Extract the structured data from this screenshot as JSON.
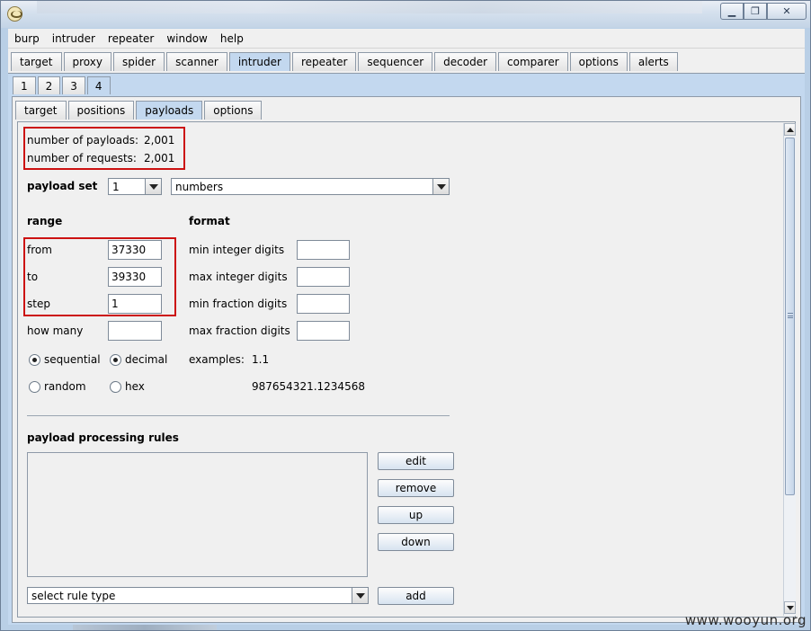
{
  "menu": [
    "burp",
    "intruder",
    "repeater",
    "window",
    "help"
  ],
  "main_tabs": [
    "target",
    "proxy",
    "spider",
    "scanner",
    "intruder",
    "repeater",
    "sequencer",
    "decoder",
    "comparer",
    "options",
    "alerts"
  ],
  "main_tabs_active": "intruder",
  "attack_tabs": [
    "1",
    "2",
    "3",
    "4"
  ],
  "attack_tabs_active": "4",
  "sub_tabs": [
    "target",
    "positions",
    "payloads",
    "options"
  ],
  "sub_tabs_active": "payloads",
  "summary": {
    "payloads_label": "number of payloads:",
    "payloads_value": "2,001",
    "requests_label": "number of requests:",
    "requests_value": "2,001"
  },
  "payload_set": {
    "label": "payload set",
    "value": "1",
    "type": "numbers"
  },
  "range": {
    "heading": "range",
    "from_label": "from",
    "from_value": "37330",
    "to_label": "to",
    "to_value": "39330",
    "step_label": "step",
    "step_value": "1",
    "how_many_label": "how many",
    "how_many_value": "",
    "sequential_label": "sequential",
    "random_label": "random",
    "order_selected": "sequential"
  },
  "format": {
    "heading": "format",
    "min_int_label": "min integer digits",
    "min_int_value": "",
    "max_int_label": "max integer digits",
    "max_int_value": "",
    "min_frac_label": "min fraction digits",
    "min_frac_value": "",
    "max_frac_label": "max fraction digits",
    "max_frac_value": "",
    "decimal_label": "decimal",
    "hex_label": "hex",
    "base_selected": "decimal",
    "examples_label": "examples:",
    "example_1": "1.1",
    "example_2": "987654321.1234568"
  },
  "rules": {
    "heading": "payload processing rules",
    "edit_label": "edit",
    "remove_label": "remove",
    "up_label": "up",
    "down_label": "down",
    "rule_type_placeholder": "select rule type",
    "add_label": "add"
  },
  "watermark": "www.wooyun.org",
  "colors": {
    "highlight_box": "#cc1111",
    "active_tab": "#c3d8ef",
    "panel_bg": "#f0f0f0"
  }
}
